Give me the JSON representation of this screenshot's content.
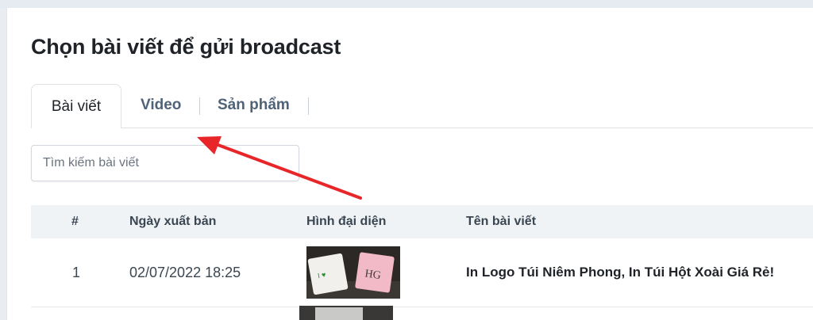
{
  "page": {
    "title": "Chọn bài viết để gửi broadcast"
  },
  "tabs": [
    {
      "label": "Bài viết",
      "active": true
    },
    {
      "label": "Video",
      "active": false
    },
    {
      "label": "Sản phẩm",
      "active": false
    }
  ],
  "search": {
    "placeholder": "Tìm kiếm bài viết",
    "value": ""
  },
  "table": {
    "headers": [
      "#",
      "Ngày xuất bản",
      "Hình đại diện",
      "Tên bài viết"
    ],
    "rows": [
      {
        "index": "1",
        "date": "02/07/2022 18:25",
        "thumbnail": "post-thumbnail-image",
        "name": "In Logo Túi Niêm Phong, In Túi Hột Xoài Giá Rẻ!"
      }
    ]
  },
  "annotation": {
    "arrow_color": "#e8262a",
    "icon": "arrow-pointer"
  }
}
